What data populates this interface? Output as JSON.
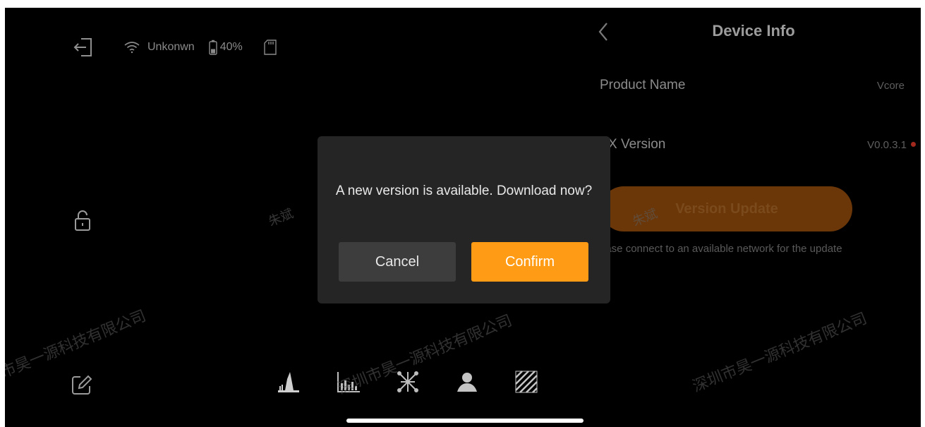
{
  "status_bar": {
    "network_label": "Unkonwn",
    "battery_label": "40%",
    "battery_level": 0.4
  },
  "panel": {
    "title": "Device Info",
    "product_name_label": "Product Name",
    "product_name_value": "Vcore",
    "version_label": "X Version",
    "version_value": "V0.0.3.1",
    "update_button_label": "Version Update",
    "hint_text": "ease connect to an available network for the update"
  },
  "dialog": {
    "message": "A new version is available. Download now?",
    "cancel_label": "Cancel",
    "confirm_label": "Confirm"
  },
  "watermarks": {
    "company": "深圳市昊一源科技有限公司",
    "company_left": "市昊一源科技有限公司",
    "name": "朱斌"
  },
  "colors": {
    "background": "#000000",
    "dialog_bg": "#252525",
    "confirm_bg": "#ff9b14",
    "cancel_bg": "#3d3d3d",
    "update_button_bg": "#6b3708",
    "update_dot": "#a3291e"
  },
  "icons": {
    "exit": "exit-icon",
    "wifi": "wifi-icon",
    "battery": "battery-icon",
    "sd_card": "sd-card-icon",
    "unlock": "unlock-icon",
    "edit": "edit-icon",
    "back": "chevron-left-icon",
    "tools": [
      "histogram-icon",
      "waveform-icon",
      "vectorscope-icon",
      "false-color-icon",
      "zebra-icon"
    ]
  }
}
